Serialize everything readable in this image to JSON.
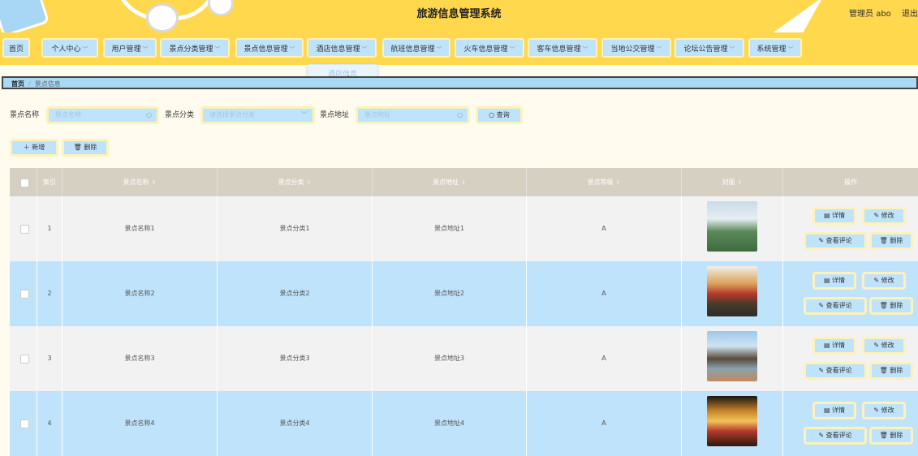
{
  "header": {
    "title": "旅游信息管理系统",
    "user_label": "管理员 abo",
    "logout_label": "退出"
  },
  "nav": {
    "items": [
      {
        "label": "首页",
        "has_arrow": false
      },
      {
        "label": "个人中心",
        "has_arrow": true
      },
      {
        "label": "用户管理",
        "has_arrow": true
      },
      {
        "label": "景点分类管理",
        "has_arrow": true
      },
      {
        "label": "景点信息管理",
        "has_arrow": true
      },
      {
        "label": "酒店信息管理",
        "has_arrow": true
      },
      {
        "label": "航班信息管理",
        "has_arrow": true
      },
      {
        "label": "火车信息管理",
        "has_arrow": true
      },
      {
        "label": "客车信息管理",
        "has_arrow": true
      },
      {
        "label": "当地公交管理",
        "has_arrow": true
      },
      {
        "label": "论坛公告管理",
        "has_arrow": true
      },
      {
        "label": "系统管理",
        "has_arrow": true
      }
    ],
    "dropdown_item": "酒店信息"
  },
  "breadcrumb": {
    "home": "首页",
    "separator": "/",
    "current": "景点信息"
  },
  "search": {
    "name_label": "景点名称",
    "name_placeholder": "景点名称",
    "category_label": "景点分类",
    "category_placeholder": "请选择景点分类",
    "address_label": "景点地址",
    "address_placeholder": "景点地址",
    "query_label": "查询"
  },
  "actions": {
    "add_label": "新增",
    "delete_label": "删除"
  },
  "table": {
    "columns": [
      "索引",
      "景点名称",
      "景点分类",
      "景点地址",
      "景点等级",
      "封面",
      "操作"
    ],
    "rows": [
      {
        "index": "1",
        "name": "景点名称1",
        "category": "景点分类1",
        "address": "景点地址1",
        "level": "A"
      },
      {
        "index": "2",
        "name": "景点名称2",
        "category": "景点分类2",
        "address": "景点地址2",
        "level": "A"
      },
      {
        "index": "3",
        "name": "景点名称3",
        "category": "景点分类3",
        "address": "景点地址3",
        "level": "A"
      },
      {
        "index": "4",
        "name": "景点名称4",
        "category": "景点分类4",
        "address": "景点地址4",
        "level": "A"
      }
    ],
    "row_actions": {
      "detail": "详情",
      "edit": "修改",
      "comments": "查看评论",
      "delete": "删除"
    }
  },
  "colors": {
    "header_bg": "#ffd84d",
    "button_bg": "#bfe3fb",
    "button_border": "#fdf2b8",
    "page_bg": "#fffcef",
    "table_header_bg": "#d5d0c2",
    "row_odd_bg": "#f2f2f2",
    "row_even_bg": "#bfe3fb"
  }
}
